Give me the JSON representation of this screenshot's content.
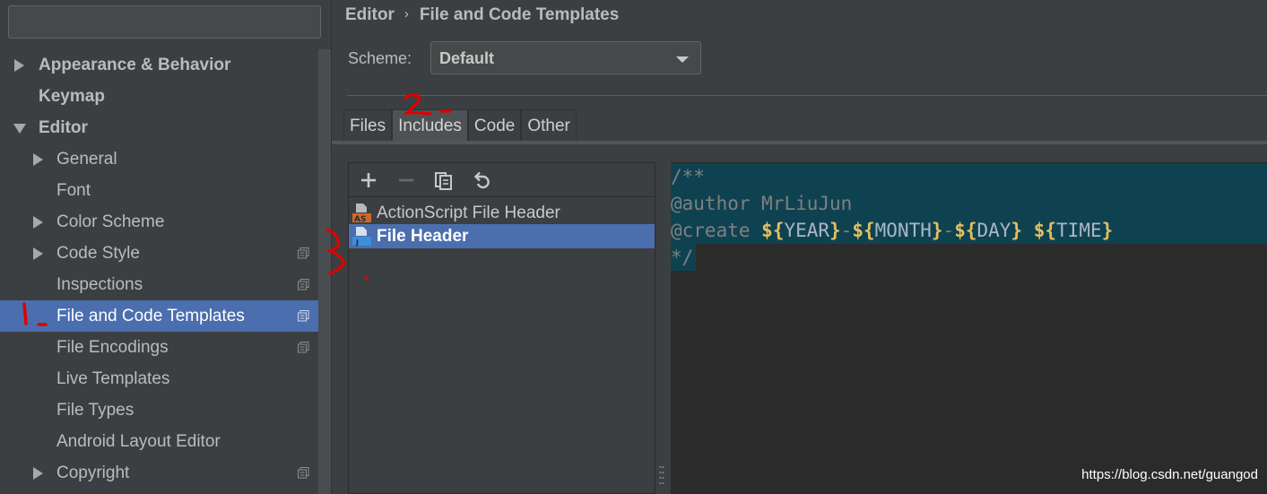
{
  "sidebar": {
    "search": {
      "value": ""
    },
    "items": [
      {
        "label": "Appearance & Behavior",
        "arrow": "right",
        "bold": true,
        "project_icon": false
      },
      {
        "label": "Keymap",
        "arrow": "none",
        "bold": true,
        "project_icon": false
      },
      {
        "label": "Editor",
        "arrow": "down",
        "bold": true,
        "project_icon": false
      },
      {
        "label": "General",
        "arrow": "right",
        "bold": false,
        "project_icon": false
      },
      {
        "label": "Font",
        "arrow": "none",
        "bold": false,
        "project_icon": false
      },
      {
        "label": "Color Scheme",
        "arrow": "right",
        "bold": false,
        "project_icon": false
      },
      {
        "label": "Code Style",
        "arrow": "right",
        "bold": false,
        "project_icon": true
      },
      {
        "label": "Inspections",
        "arrow": "none",
        "bold": false,
        "project_icon": true
      },
      {
        "label": "File and Code Templates",
        "arrow": "none",
        "bold": false,
        "project_icon": true,
        "selected": true
      },
      {
        "label": "File Encodings",
        "arrow": "none",
        "bold": false,
        "project_icon": true
      },
      {
        "label": "Live Templates",
        "arrow": "none",
        "bold": false,
        "project_icon": false
      },
      {
        "label": "File Types",
        "arrow": "none",
        "bold": false,
        "project_icon": false
      },
      {
        "label": "Android Layout Editor",
        "arrow": "none",
        "bold": false,
        "project_icon": false
      },
      {
        "label": "Copyright",
        "arrow": "right",
        "bold": false,
        "project_icon": true
      }
    ]
  },
  "breadcrumb": {
    "parent": "Editor",
    "separator": "›",
    "current": "File and Code Templates"
  },
  "scheme": {
    "label": "Scheme:",
    "value": "Default"
  },
  "tabs": [
    {
      "label": "Files",
      "active": false
    },
    {
      "label": "Includes",
      "active": true
    },
    {
      "label": "Code",
      "active": false
    },
    {
      "label": "Other",
      "active": false
    }
  ],
  "toolbar": {
    "icons": [
      "add-icon",
      "remove-icon",
      "copy-icon",
      "reset-icon"
    ]
  },
  "templates": [
    {
      "label": "ActionScript File Header",
      "icon": "actionscript-file-icon",
      "badge": "AS",
      "selected": false
    },
    {
      "label": "File Header",
      "icon": "java-file-icon",
      "badge": "J",
      "selected": true
    }
  ],
  "editor": {
    "line1": {
      "text": "/**"
    },
    "line2": {
      "kw": "@author",
      "sp": " ",
      "name": "MrLiuJun"
    },
    "line3": {
      "kw": "@create",
      "sp1": " ",
      "d1": "${",
      "v1": "YEAR",
      "e1": "}",
      "dash1": "-",
      "d2": "${",
      "v2": "MONTH",
      "e2": "}",
      "dash2": "-",
      "d3": "${",
      "v3": "DAY",
      "e3": "}",
      "sp2": " ",
      "d4": "${",
      "v4": "TIME",
      "e4": "}"
    },
    "line4": {
      "text": "*/"
    }
  },
  "watermark": "https://blog.csdn.net/guangod",
  "colors": {
    "selection": "#4b6eaf",
    "background": "#3c3f41",
    "editor_selection": "#0f4251",
    "annotation": "#e00000"
  }
}
